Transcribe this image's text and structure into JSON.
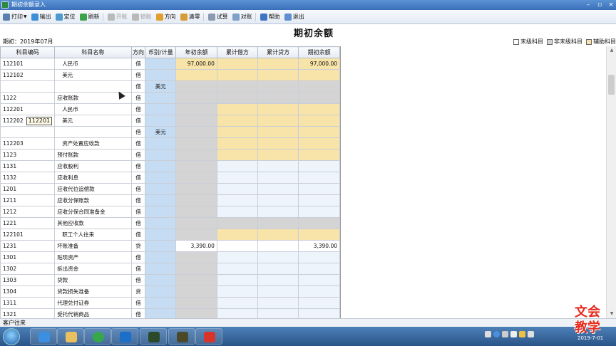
{
  "window": {
    "title": "期初余额录入"
  },
  "toolbar": [
    {
      "id": "print",
      "label": "打印",
      "icon": "printer-icon",
      "dropdown": true,
      "disabled": false,
      "color": "#5a7fb0"
    },
    {
      "id": "export",
      "label": "输出",
      "icon": "export-icon",
      "disabled": false,
      "color": "#3c8fd6"
    },
    {
      "id": "locate",
      "label": "定位",
      "icon": "locate-icon",
      "disabled": false,
      "color": "#4b9ad0"
    },
    {
      "id": "refresh",
      "label": "刷新",
      "icon": "refresh-icon",
      "disabled": false,
      "color": "#3ba34a"
    },
    {
      "id": "open_account",
      "label": "开账",
      "icon": "open-account-icon",
      "disabled": true,
      "color": "#b9b9b9"
    },
    {
      "id": "lock_account",
      "label": "锁账",
      "icon": "lock-account-icon",
      "disabled": true,
      "color": "#b9b9b9"
    },
    {
      "id": "direction",
      "label": "方向",
      "icon": "direction-icon",
      "disabled": false,
      "color": "#e0a030"
    },
    {
      "id": "clear",
      "label": "清零",
      "icon": "clear-icon",
      "disabled": false,
      "color": "#d79b3a"
    },
    {
      "id": "trial",
      "label": "试算",
      "icon": "trial-balance-icon",
      "disabled": false,
      "color": "#8a9bb0"
    },
    {
      "id": "reconcile",
      "label": "对账",
      "icon": "reconcile-icon",
      "disabled": false,
      "color": "#7fa0c8"
    },
    {
      "id": "help",
      "label": "帮助",
      "icon": "help-icon",
      "disabled": false,
      "color": "#3f74c2"
    },
    {
      "id": "exit",
      "label": "退出",
      "icon": "exit-icon",
      "disabled": false,
      "color": "#5f8fcf"
    }
  ],
  "heading": "期初余额",
  "period": "期初：2019年07月",
  "legend": [
    "末级科目",
    "非末级科目",
    "辅助科目"
  ],
  "columns": [
    "科目编码",
    "科目名称",
    "方向",
    "币别/计量",
    "年初余额",
    "累计借方",
    "累计贷方",
    "期初余额"
  ],
  "rows": [
    {
      "code": "112101",
      "name": "人民币",
      "lvl": 2,
      "dir": "借",
      "cur": "",
      "open": "97,000.00",
      "end": "97,000.00",
      "type": "leaf-yellow"
    },
    {
      "code": "112102",
      "name": "美元",
      "lvl": 2,
      "dir": "借",
      "cur": "",
      "open": "",
      "end": "",
      "type": "leaf-yellow"
    },
    {
      "code": "",
      "name": "",
      "lvl": 1,
      "dir": "借",
      "cur": "美元",
      "open": "",
      "end": "",
      "type": "gray"
    },
    {
      "code": "1122",
      "name": "应收账款",
      "lvl": 1,
      "dir": "借",
      "cur": "",
      "open": "",
      "end": "",
      "type": "gray"
    },
    {
      "code": "112201",
      "name": "人民币",
      "lvl": 2,
      "dir": "借",
      "cur": "",
      "open": "",
      "end": "",
      "type": "leaf-yellow"
    },
    {
      "code": "112202",
      "name": "美元",
      "lvl": 2,
      "dir": "借",
      "cur": "",
      "open": "",
      "end": "",
      "type": "leaf-yellow",
      "edit": "112201"
    },
    {
      "code": "",
      "name": "",
      "lvl": 1,
      "dir": "借",
      "cur": "美元",
      "open": "",
      "end": "",
      "type": "leaf-yellow"
    },
    {
      "code": "112203",
      "name": "资产处置应收款",
      "lvl": 2,
      "dir": "借",
      "cur": "",
      "open": "",
      "end": "",
      "type": "leaf-yellow"
    },
    {
      "code": "1123",
      "name": "预付账款",
      "lvl": 1,
      "dir": "借",
      "cur": "",
      "open": "",
      "end": "",
      "type": "leaf-yellow"
    },
    {
      "code": "1131",
      "name": "应收股利",
      "lvl": 1,
      "dir": "借",
      "cur": "",
      "open": "",
      "end": "",
      "type": "blue"
    },
    {
      "code": "1132",
      "name": "应收利息",
      "lvl": 1,
      "dir": "借",
      "cur": "",
      "open": "",
      "end": "",
      "type": "blue"
    },
    {
      "code": "1201",
      "name": "应收代位追偿款",
      "lvl": 1,
      "dir": "借",
      "cur": "",
      "open": "",
      "end": "",
      "type": "blue"
    },
    {
      "code": "1211",
      "name": "应收分保账款",
      "lvl": 1,
      "dir": "借",
      "cur": "",
      "open": "",
      "end": "",
      "type": "blue"
    },
    {
      "code": "1212",
      "name": "应收分保合同准备金",
      "lvl": 1,
      "dir": "借",
      "cur": "",
      "open": "",
      "end": "",
      "type": "blue"
    },
    {
      "code": "1221",
      "name": "其他应收款",
      "lvl": 1,
      "dir": "借",
      "cur": "",
      "open": "",
      "end": "",
      "type": "gray"
    },
    {
      "code": "122101",
      "name": "职工个人往来",
      "lvl": 2,
      "dir": "借",
      "cur": "",
      "open": "",
      "end": "",
      "type": "leaf-yellow"
    },
    {
      "code": "1231",
      "name": "坏账准备",
      "lvl": 1,
      "dir": "贷",
      "cur": "",
      "open": "3,390.00",
      "end": "3,390.00",
      "type": "white"
    },
    {
      "code": "1301",
      "name": "贴现资产",
      "lvl": 1,
      "dir": "借",
      "cur": "",
      "open": "",
      "end": "",
      "type": "blue"
    },
    {
      "code": "1302",
      "name": "拆出资金",
      "lvl": 1,
      "dir": "借",
      "cur": "",
      "open": "",
      "end": "",
      "type": "blue"
    },
    {
      "code": "1303",
      "name": "贷款",
      "lvl": 1,
      "dir": "借",
      "cur": "",
      "open": "",
      "end": "",
      "type": "blue"
    },
    {
      "code": "1304",
      "name": "贷款损失准备",
      "lvl": 1,
      "dir": "贷",
      "cur": "",
      "open": "",
      "end": "",
      "type": "blue"
    },
    {
      "code": "1311",
      "name": "代理兑付证券",
      "lvl": 1,
      "dir": "借",
      "cur": "",
      "open": "",
      "end": "",
      "type": "blue"
    },
    {
      "code": "1321",
      "name": "受托代销商品",
      "lvl": 1,
      "dir": "借",
      "cur": "",
      "open": "",
      "end": "",
      "type": "blue"
    }
  ],
  "status": {
    "text": "客户往来"
  },
  "watermark": [
    "文会",
    "教学"
  ],
  "clock": "2019-7-01",
  "colors": {
    "yellow": "#f8e4a8",
    "gray": "#d4d4d4",
    "blue": "#edf4fc",
    "currency": "#c6dcf2"
  }
}
